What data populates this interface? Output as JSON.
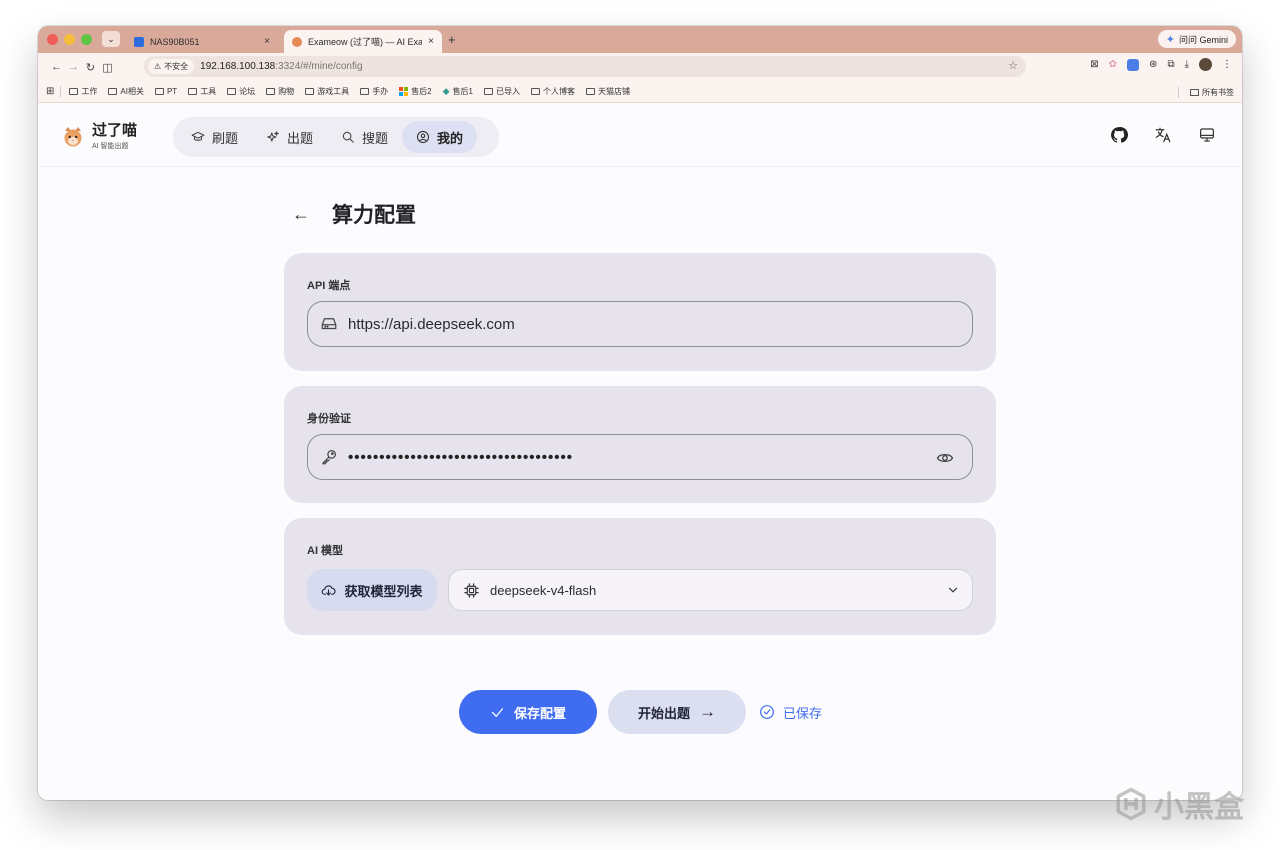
{
  "browser": {
    "tabs": [
      {
        "title": "NAS90B051",
        "close": "×"
      },
      {
        "title": "Exameow (过了喵) — AI Exam",
        "close": "×"
      }
    ],
    "new_tab": "+",
    "gemini_label": "问问 Gemini",
    "security_chip": "不安全",
    "url_host": "192.168.100.138",
    "url_path": ":3324/#/mine/config",
    "bookmarks": [
      "工作",
      "AI相关",
      "PT",
      "工具",
      "论坛",
      "购物",
      "游戏工具",
      "手办",
      "售后2",
      "售后1",
      "已导入",
      "个人博客",
      "天猫店铺"
    ],
    "all_bookmarks": "所有书签"
  },
  "app": {
    "brand_name": "过了喵",
    "brand_sub": "AI 智能出题",
    "nav": [
      {
        "label": "刷题",
        "icon": "graduation-cap-icon"
      },
      {
        "label": "出题",
        "icon": "sparkles-icon"
      },
      {
        "label": "搜题",
        "icon": "search-icon"
      },
      {
        "label": "我的",
        "icon": "user-circle-icon",
        "active": true
      }
    ]
  },
  "page": {
    "back": "←",
    "title": "算力配置",
    "endpoint": {
      "label": "API 端点",
      "value": "https://api.deepseek.com"
    },
    "auth": {
      "label": "身份验证",
      "masked_value": "••••••••••••••••••••••••••••••••••••"
    },
    "model": {
      "label": "AI 模型",
      "fetch_button": "获取模型列表",
      "selected": "deepseek-v4-flash"
    },
    "save_button": "保存配置",
    "start_button": "开始出题",
    "start_arrow": "→",
    "saved_status": "已保存"
  },
  "colors": {
    "accent": "#3f6cf0",
    "card_bg": "#e6e3ec",
    "tab_strip": "#d9a999",
    "toolbar": "#fbf3f0"
  },
  "watermark": "小黑盒"
}
